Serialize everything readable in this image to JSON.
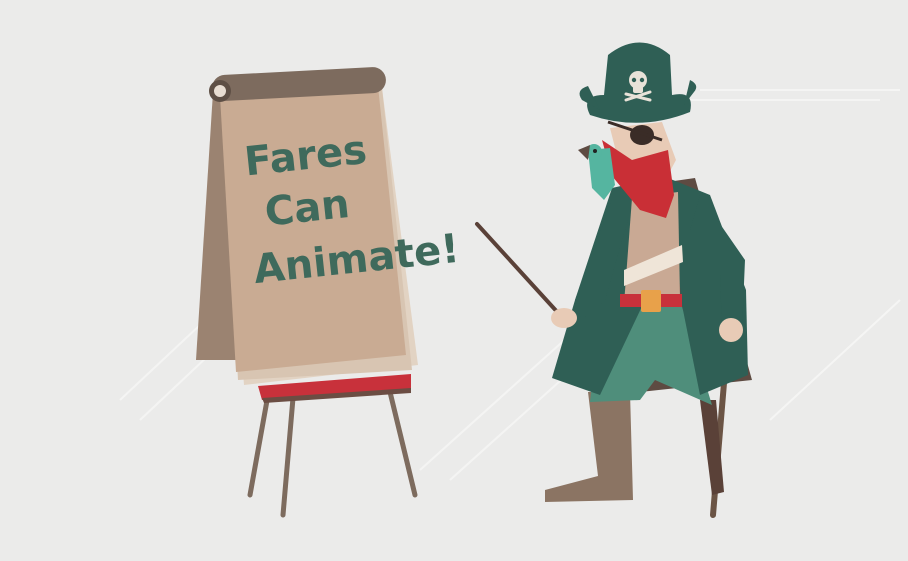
{
  "sign": {
    "line1": "Fares",
    "line2": "Can",
    "line3": "Animate!"
  },
  "colors": {
    "background": "#ebebea",
    "paper": "#c9ab93",
    "paper_shadow": "#9b8371",
    "easel_wood": "#7d6b5e",
    "easel_red": "#c8313b",
    "coat_green": "#2f5f55",
    "pants_green": "#4f8e7b",
    "beard_red": "#c92f36",
    "boot_brown": "#8b7463",
    "skin": "#e8cbb6",
    "text_green": "#3f6a5c"
  },
  "icons": [
    "skull-icon"
  ]
}
